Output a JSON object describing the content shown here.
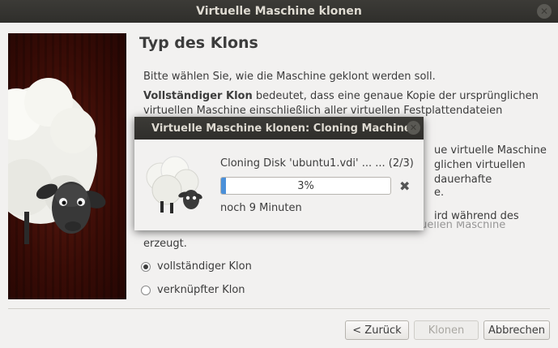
{
  "window": {
    "title": "Virtuelle Maschine klonen"
  },
  "wizard": {
    "page_title": "Typ des Klons",
    "intro": "Bitte wählen Sie, wie die Maschine geklont werden soll.",
    "full_clone_term": "Vollständiger Klon",
    "full_clone_desc_line1": " bedeutet, dass eine genaue Kopie der ursprünglichen",
    "full_clone_desc_line2": "virtuellen Maschine einschließlich aller virtuellen Festplattendateien",
    "frag_line1": "ue virtuelle Maschine",
    "frag_line2": "glichen virtuellen",
    "frag_line3": "dauerhafte",
    "frag_line4": "e.",
    "frag_line5": "ird während des",
    "linked_line2_partial": "Klonens ein Sicherungspunkt der ursprünglichen virtuellen Maschine",
    "linked_line3": "erzeugt.",
    "options": [
      {
        "label": "vollständiger Klon",
        "checked": true
      },
      {
        "label": "verknüpfter Klon",
        "checked": false
      }
    ]
  },
  "buttons": {
    "back": "< Zurück",
    "clone": "Klonen",
    "cancel": "Abbrechen"
  },
  "progress_dialog": {
    "title": "Virtuelle Maschine klonen: Cloning Machine",
    "operation": "Cloning Disk 'ubuntu1.vdi' ... ... (2/3)",
    "percent_label": "3%",
    "percent_value": 3,
    "remaining": "noch 9 Minuten",
    "cancel_icon": "close-x-icon"
  },
  "colors": {
    "titlebar": "#3c3b37",
    "progress": "#4a90d9",
    "image_bg": "#3a0c06"
  }
}
